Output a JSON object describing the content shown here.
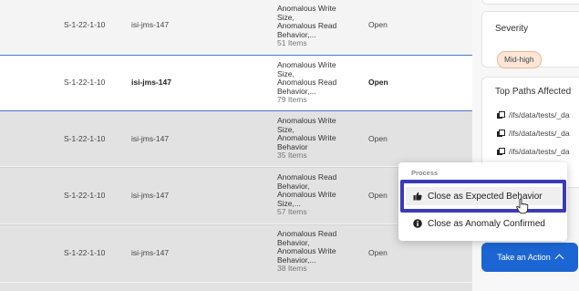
{
  "rows": [
    {
      "id": "S-1-22-1-10",
      "host": "isi-jms-147",
      "alerts": [
        "Anomalous Write",
        "Size,",
        "Anomalous Read",
        "Behavior,..."
      ],
      "count": "51 Items",
      "status": "Open"
    },
    {
      "id": "S-1-22-1-10",
      "host": "isi-jms-147",
      "alerts": [
        "Anomalous Write",
        "Size,",
        "Anomalous Read",
        "Behavior,..."
      ],
      "count": "79 Items",
      "status": "Open"
    },
    {
      "id": "S-1-22-1-10",
      "host": "isi-jms-147",
      "alerts": [
        "Anomalous Write",
        "Size,",
        "Anomalous Write",
        "Behavior"
      ],
      "count": "35 Items",
      "status": "Open"
    },
    {
      "id": "S-1-22-1-10",
      "host": "isi-jms-147",
      "alerts": [
        "Anomalous Read",
        "Behavior,",
        "Anomalous Write",
        "Size,..."
      ],
      "count": "57 Items",
      "status": "Open"
    },
    {
      "id": "S-1-22-1-10",
      "host": "isi-jms-147",
      "alerts": [
        "Anomalous Read",
        "Behavior,",
        "Anomalous Write",
        "Behavior,..."
      ],
      "count": "38 Items",
      "status": "Open"
    }
  ],
  "severity": {
    "title": "Severity",
    "value": "Mid-high",
    "badge_bg": "#fde6d8",
    "badge_border": "#f0b496"
  },
  "top_paths": {
    "title": "Top Paths Affected",
    "items": [
      "/ifs/data/tests/_da",
      "/ifs/data/tests/_da",
      "/ifs/data/tests/_da"
    ]
  },
  "menu": {
    "heading": "Process",
    "items": [
      {
        "label": "Close as Expected Behavior",
        "icon": "thumbs-up-icon"
      },
      {
        "label": "Close as Anomaly Confirmed",
        "icon": "info-icon"
      }
    ]
  },
  "action_button": {
    "label": "Take an Action",
    "color": "#1c66d4"
  },
  "highlight_color": "#3b3bb8"
}
